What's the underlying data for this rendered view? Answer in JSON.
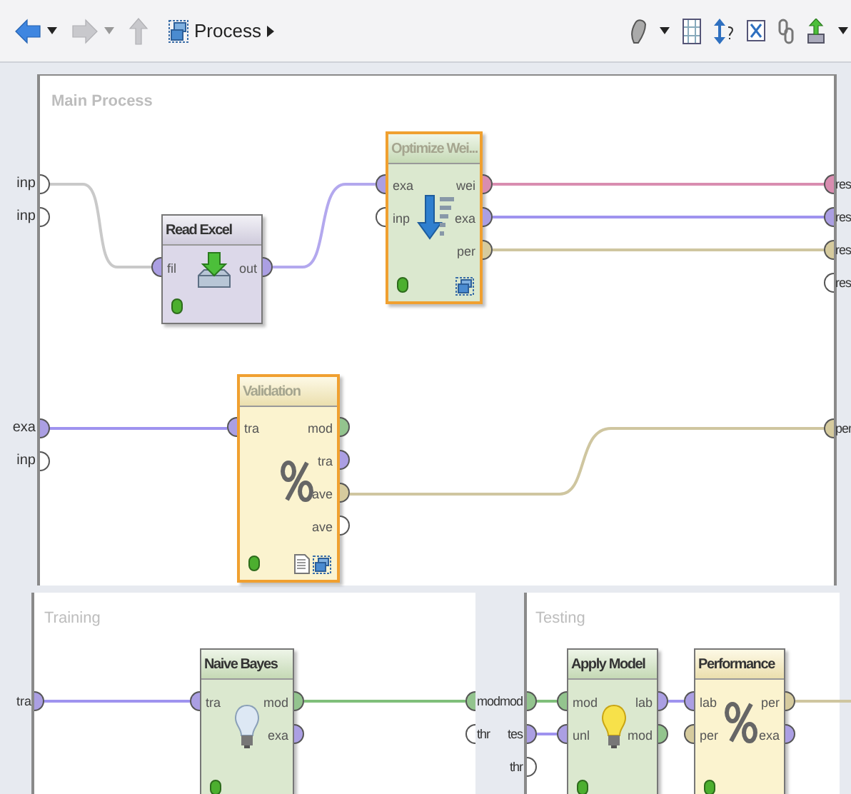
{
  "toolbar": {
    "nav": [
      {
        "kind": "back",
        "disabled": false
      },
      {
        "kind": "forward",
        "disabled": true
      },
      {
        "kind": "up",
        "disabled": true
      }
    ],
    "breadcrumb": "Process"
  },
  "main_process": {
    "title": "Main Process",
    "input_ports": [
      {
        "label": "inp",
        "color": "#ffffff"
      },
      {
        "label": "inp",
        "color": "#ffffff"
      },
      {
        "label": "exa",
        "color": "#ab9fe3"
      },
      {
        "label": "inp",
        "color": "#ffffff"
      }
    ],
    "output_ports": [
      {
        "label": "res",
        "color": "#d98db0"
      },
      {
        "label": "res",
        "color": "#ab9fe3"
      },
      {
        "label": "res",
        "color": "#d6cb9e"
      },
      {
        "label": "res",
        "color": "#ffffff"
      },
      {
        "label": "per",
        "color": "#d6cb9e"
      }
    ],
    "operators": [
      {
        "name": "Read Excel",
        "kind": "import",
        "selected": false,
        "ports_in": [
          {
            "label": "fil",
            "color": "#ab9fe3"
          }
        ],
        "ports_out": [
          {
            "label": "out",
            "color": "#ab9fe3"
          }
        ]
      },
      {
        "name": "Optimize Wei...",
        "kind": "modeling",
        "selected": true,
        "ports_in": [
          {
            "label": "exa",
            "color": "#ab9fe3"
          },
          {
            "label": "inp",
            "color": "#ffffff"
          }
        ],
        "ports_out": [
          {
            "label": "wei",
            "color": "#d98db0"
          },
          {
            "label": "exa",
            "color": "#ab9fe3"
          },
          {
            "label": "per",
            "color": "#d6cb9e"
          }
        ]
      },
      {
        "name": "Validation",
        "kind": "evaluation",
        "selected": true,
        "ports_in": [
          {
            "label": "tra",
            "color": "#ab9fe3"
          }
        ],
        "ports_out": [
          {
            "label": "mod",
            "color": "#93c48e"
          },
          {
            "label": "tra",
            "color": "#ab9fe3"
          },
          {
            "label": "ave",
            "color": "#d6cb9e"
          },
          {
            "label": "ave",
            "color": "#ffffff"
          }
        ]
      }
    ]
  },
  "training": {
    "title": "Training",
    "input_ports": [
      {
        "label": "tra",
        "color": "#ab9fe3"
      }
    ],
    "output_ports": [
      {
        "label": "mod",
        "color": "#93c48e"
      },
      {
        "label": "thr",
        "color": "#ffffff"
      }
    ],
    "operators": [
      {
        "name": "Naive Bayes",
        "kind": "modeling",
        "selected": false,
        "ports_in": [
          {
            "label": "tra",
            "color": "#ab9fe3"
          }
        ],
        "ports_out": [
          {
            "label": "mod",
            "color": "#93c48e"
          },
          {
            "label": "exa",
            "color": "#ab9fe3"
          }
        ]
      }
    ]
  },
  "testing": {
    "title": "Testing",
    "input_ports": [
      {
        "label": "mod",
        "color": "#93c48e"
      },
      {
        "label": "tes",
        "color": "#ab9fe3"
      },
      {
        "label": "thr",
        "color": "#ffffff"
      }
    ],
    "operators": [
      {
        "name": "Apply Model",
        "kind": "modeling",
        "selected": false,
        "ports_in": [
          {
            "label": "mod",
            "color": "#93c48e"
          },
          {
            "label": "unl",
            "color": "#ab9fe3"
          }
        ],
        "ports_out": [
          {
            "label": "lab",
            "color": "#ab9fe3"
          },
          {
            "label": "mod",
            "color": "#93c48e"
          }
        ]
      },
      {
        "name": "Performance",
        "kind": "evaluation",
        "selected": false,
        "ports_in": [
          {
            "label": "lab",
            "color": "#ab9fe3"
          },
          {
            "label": "per",
            "color": "#d6cb9e"
          }
        ],
        "ports_out": [
          {
            "label": "per",
            "color": "#d6cb9e"
          },
          {
            "label": "exa",
            "color": "#ab9fe3"
          }
        ]
      }
    ]
  },
  "connections": [
    {
      "color": "#c9c9c9"
    },
    {
      "color": "#b3a8ee"
    },
    {
      "color": "#d98db0"
    },
    {
      "color": "#9f93ef"
    },
    {
      "color": "#cfc6a0"
    },
    {
      "color": "#9f93ef"
    },
    {
      "color": "#cfc6a0"
    },
    {
      "color": "#9f93ef"
    },
    {
      "color": "#7fbf7a"
    },
    {
      "color": "#7fbf7a"
    },
    {
      "color": "#9f93ef"
    },
    {
      "color": "#9f93ef"
    },
    {
      "color": "#cfc6a0"
    }
  ]
}
